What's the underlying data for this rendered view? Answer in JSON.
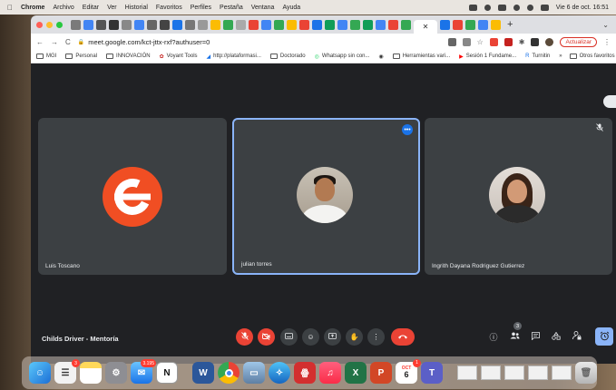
{
  "menubar": {
    "app_name": "Chrome",
    "items": [
      "Archivo",
      "Editar",
      "Ver",
      "Historial",
      "Favoritos",
      "Perfiles",
      "Pestaña",
      "Ventana",
      "Ayuda"
    ],
    "clock": "Vie 6 de oct.  16:51"
  },
  "browser": {
    "url": "meet.google.com/kct-jttx-rxf?authuser=0",
    "update_label": "Actualizar",
    "bookmarks": [
      "MGI",
      "Personal",
      "INNOVACIÓN",
      "Voyant Tools",
      "http://plataformasi...",
      "Doctorado",
      "Whatsapp sin con...",
      "Herramientas vari...",
      "Sesión 1 Fundame...",
      "Turnitin"
    ],
    "other_bookmarks": "Otros favoritos",
    "overflow": "»"
  },
  "meet": {
    "participants": [
      {
        "name": "Luis Toscano",
        "avatar": "letter-e-logo",
        "avatar_color": "#f04e23"
      },
      {
        "name": "julian torres",
        "avatar": "photo-male",
        "active_speaker": true
      },
      {
        "name": "Ingrith Dayana Rodriguez Gutierrez",
        "avatar": "photo-female",
        "muted": true
      }
    ],
    "meeting_name": "Childs Driver - Mentoría",
    "people_count": "3",
    "active_border_color": "#8ab4f8",
    "end_call_color": "#ea4335"
  },
  "dock": {
    "mail_badge": "3.195",
    "reminders_badge": "3",
    "calendar_month": "OCT",
    "calendar_day": "6",
    "calendar_badge": "1"
  }
}
